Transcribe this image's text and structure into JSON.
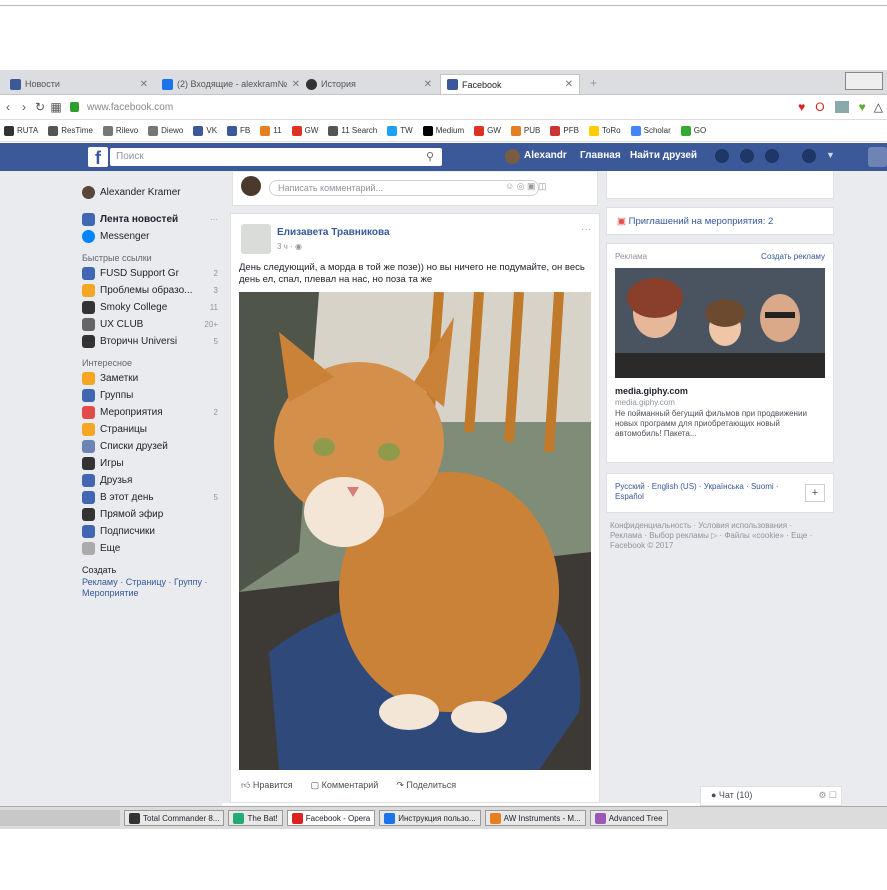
{
  "browser": {
    "tabs": [
      {
        "label": "Новости",
        "favicon_color": "#3b5998"
      },
      {
        "label": "(2) Входящие - alexkram№",
        "favicon_color": "#1a73e8"
      },
      {
        "label": "История",
        "favicon_color": "#333333"
      },
      {
        "label": "Facebook",
        "favicon_color": "#3b5998"
      }
    ],
    "url": "www.facebook.com",
    "bookmarks": [
      "RUTA",
      "ResTime",
      "Rilevo",
      "Diewo",
      "VK",
      "FB",
      "11",
      "GW",
      "11 Search",
      "TW",
      "Medium",
      "GW",
      "PUB",
      "PFB",
      "ToRo",
      "Scholar",
      "GO"
    ]
  },
  "fb": {
    "logo": "f",
    "search_placeholder": "Поиск",
    "user": "Alexandr",
    "home": "Главная",
    "find_friends": "Найти друзей"
  },
  "left": {
    "profile": "Alexander Kramer",
    "news_feed": "Лента новостей",
    "messenger": "Messenger",
    "shortcuts_title": "Быстрые ссылки",
    "shortcuts": [
      {
        "label": "FUSD Support Gr",
        "count": "2"
      },
      {
        "label": "Проблемы образо...",
        "count": "3"
      },
      {
        "label": "Smoky College",
        "count": "11"
      },
      {
        "label": "UX CLUB",
        "count": "20+"
      },
      {
        "label": "Вторичн Universi",
        "count": "5"
      }
    ],
    "explore_title": "Интересное",
    "explore": [
      {
        "label": "Заметки",
        "count": ""
      },
      {
        "label": "Группы",
        "count": ""
      },
      {
        "label": "Мероприятия",
        "count": "2"
      },
      {
        "label": "Страницы",
        "count": ""
      },
      {
        "label": "Списки друзей",
        "count": ""
      },
      {
        "label": "Игры",
        "count": ""
      },
      {
        "label": "Друзья",
        "count": ""
      },
      {
        "label": "В этот день",
        "count": "5"
      },
      {
        "label": "Прямой эфир",
        "count": ""
      },
      {
        "label": "Подписчики",
        "count": ""
      },
      {
        "label": "Еще",
        "count": ""
      }
    ],
    "create_title": "Создать",
    "create_links": "Рекламу · Страницу · Группу · Мероприятие"
  },
  "comment": {
    "placeholder": "Написать комментарий..."
  },
  "post": {
    "author": "Елизавета Травникова",
    "time": "3 ч · ◉",
    "text": "День следующий, а морда в той же позе)) но вы ничего не подумайте, он весь день ел, спал, плевал на нас, но поза та же",
    "like": "Нравится",
    "comment": "Комментарий",
    "share": "Поделиться"
  },
  "right": {
    "invites": "Приглашений на мероприятия: 2",
    "ads_title": "Реклама",
    "ads_create": "Создать рекламу",
    "ad_domain": "media.giphy.com",
    "ad_domain2": "media.giphy.com",
    "ad_text": "Не пойманный бегущий фильмов при продвижении новых программ для приобретающих новый автомобиль! Пакета...",
    "languages": "Русский · English (US) · Українська · Suomi · Español",
    "footer": "Конфиденциальность · Условия использования · Реклама · Выбор рекламы ▷ · Файлы «cookie» · Еще · Facebook © 2017",
    "chat": "● Чат (10)"
  },
  "taskbar": [
    "Total Commander 8...",
    "The Bat!",
    "Facebook - Opera",
    "Инструкция пользо...",
    "AW Instruments - M...",
    "Advanced Tree"
  ]
}
